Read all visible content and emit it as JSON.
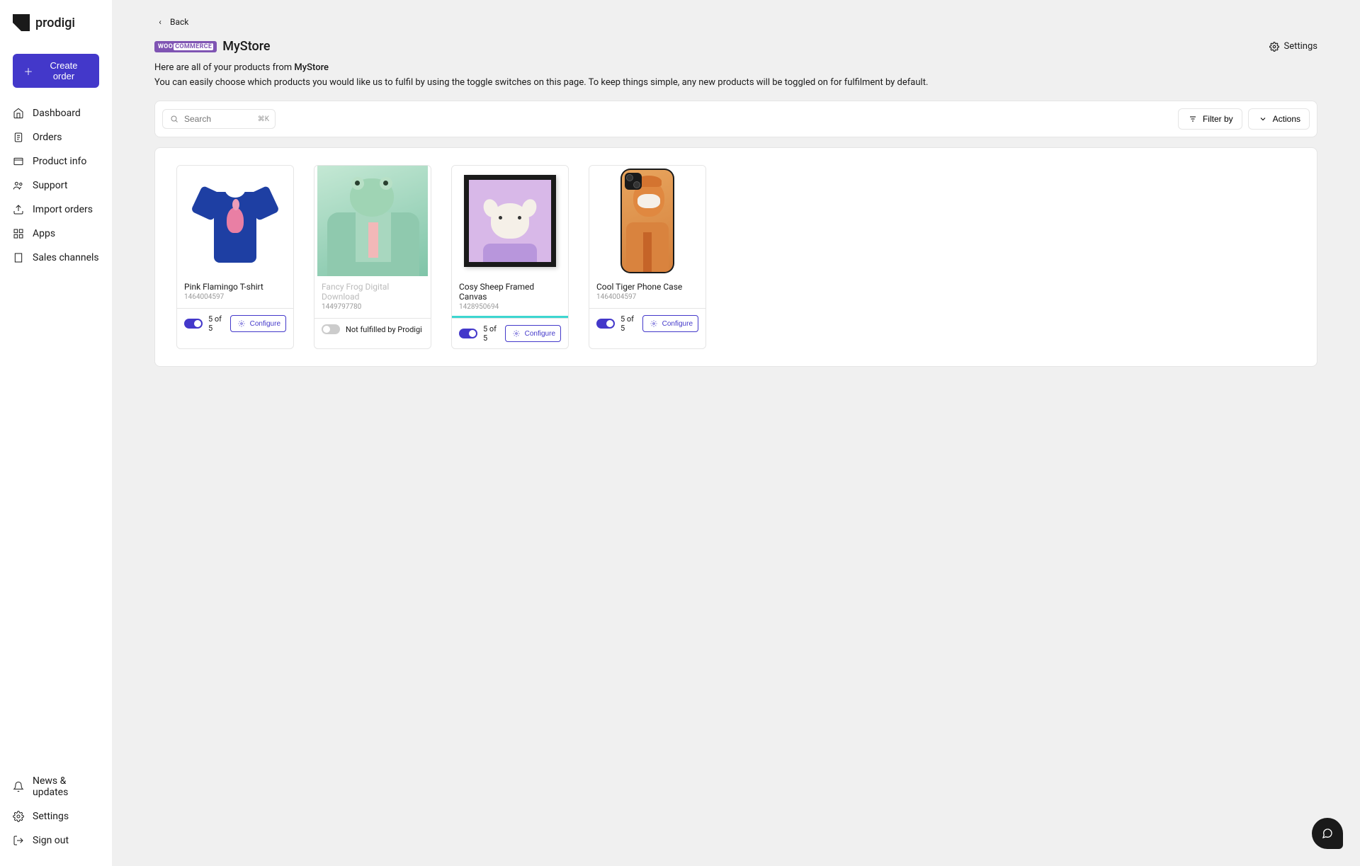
{
  "brand": "prodigi",
  "createOrder": "Create order",
  "nav": {
    "main": [
      {
        "label": "Dashboard",
        "icon": "home"
      },
      {
        "label": "Orders",
        "icon": "clipboard"
      },
      {
        "label": "Product info",
        "icon": "box"
      },
      {
        "label": "Support",
        "icon": "people"
      },
      {
        "label": "Import orders",
        "icon": "upload"
      },
      {
        "label": "Apps",
        "icon": "grid"
      },
      {
        "label": "Sales channels",
        "icon": "building"
      }
    ],
    "bottom": [
      {
        "label": "News & updates",
        "icon": "bell"
      },
      {
        "label": "Settings",
        "icon": "gear"
      },
      {
        "label": "Sign out",
        "icon": "signout"
      }
    ]
  },
  "back": "Back",
  "platform": "WOO COMMERCE",
  "storeName": "MyStore",
  "settingsLink": "Settings",
  "intro": {
    "prefix": "Here are all of your products from ",
    "store": "MyStore"
  },
  "desc": "You can easily choose which products you would like us to fulfil by using the toggle switches on this page. To keep things simple, any new products will be toggled on for fulfilment by default.",
  "search": {
    "placeholder": "Search",
    "shortcut": "⌘K"
  },
  "filterBy": "Filter by",
  "actions": "Actions",
  "configure": "Configure",
  "notFulfilled": "Not fulfilled by Prodigi",
  "products": [
    {
      "title": "Pink Flamingo T-shirt",
      "sku": "1464004597",
      "enabled": true,
      "count": "5 of 5",
      "highlighted": false,
      "thumb": "tshirt"
    },
    {
      "title": "Fancy Frog Digital Download",
      "sku": "1449797780",
      "enabled": false,
      "highlighted": false,
      "thumb": "frog"
    },
    {
      "title": "Cosy Sheep Framed Canvas",
      "sku": "1428950694",
      "enabled": true,
      "count": "5 of 5",
      "highlighted": true,
      "thumb": "sheep"
    },
    {
      "title": "Cool Tiger Phone Case",
      "sku": "1464004597",
      "enabled": true,
      "count": "5 of 5",
      "highlighted": false,
      "thumb": "tiger"
    }
  ]
}
